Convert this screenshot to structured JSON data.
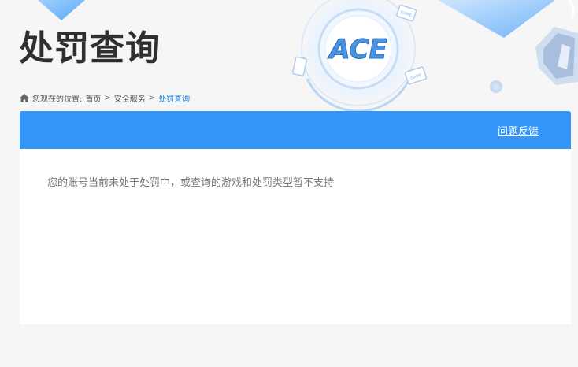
{
  "page": {
    "title": "处罚查询"
  },
  "logo": {
    "text": "ACE"
  },
  "decorations": {
    "tag_text": "GAME"
  },
  "breadcrumb": {
    "prefix": "您现在的位置:",
    "items": [
      "首页",
      "安全服务",
      "处罚查询"
    ],
    "separator": ">"
  },
  "panel": {
    "feedback_label": "问题反馈",
    "message": "您的账号当前未处于处罚中，或查询的游戏和处罚类型暂不支持"
  },
  "colors": {
    "accent": "#3395f7",
    "breadcrumb_current": "#1a7fe0",
    "title": "#2f2f2f"
  },
  "icons": {
    "breadcrumb_home": "home-icon"
  }
}
